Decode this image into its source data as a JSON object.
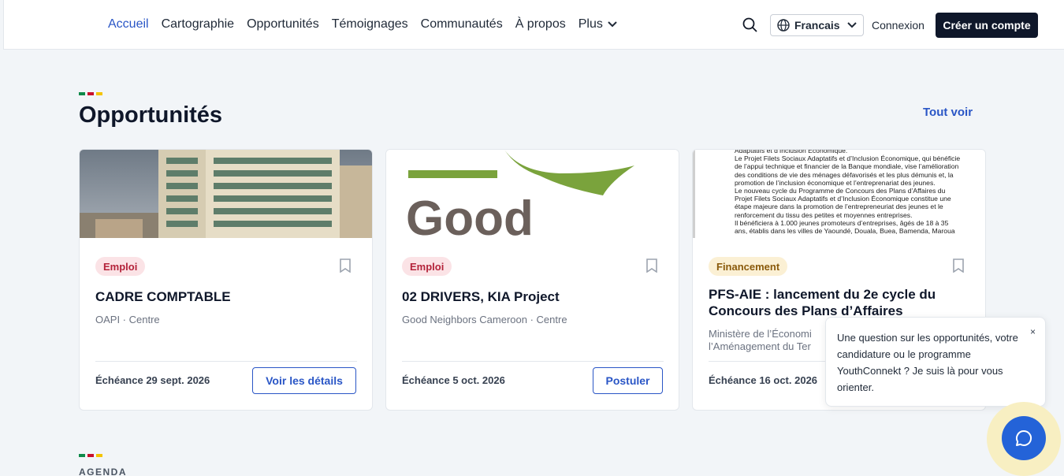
{
  "nav": {
    "items": [
      "Accueil",
      "Cartographie",
      "Opportunités",
      "Témoignages",
      "Communautés",
      "À propos"
    ],
    "more_label": "Plus",
    "active": "Accueil"
  },
  "header": {
    "language": "Francais",
    "login_label": "Connexion",
    "signup_label": "Créer un compte"
  },
  "colors": {
    "accent": "#2a56c6",
    "dark": "#0f172a",
    "flag": [
      "#0f8a4a",
      "#c8102e",
      "#f4c400"
    ]
  },
  "section": {
    "title": "Opportunités",
    "see_all_label": "Tout voir"
  },
  "cards": [
    {
      "badge": "Emploi",
      "title": "CADRE COMPTABLE",
      "subtitle": "OAPI · Centre",
      "deadline": "Échéance 29 sept. 2026",
      "cta": "Voir les détails"
    },
    {
      "badge": "Emploi",
      "image_text": "Good",
      "title": "02 DRIVERS, KIA Project",
      "subtitle": "Good Neighbors Cameroon · Centre",
      "deadline": "Échéance 5 oct. 2026",
      "cta": "Postuler"
    },
    {
      "badge": "Financement",
      "title": "PFS-AIE : lancement du 2e cycle du Concours des Plans d’Affaires",
      "subtitle_line1": "Ministère de l’Économi",
      "subtitle_line2": "l’Aménagement du Ter",
      "deadline": "Échéance 16 oct. 2026",
      "doc_lines": [
        "Adaptatifs et d’Inclusion Économique.",
        "Le Projet Filets Sociaux Adaptatifs et d’Inclusion Économique, qui bénéficie",
        "de l’appui technique et financier de la Banque mondiale, vise l’amélioration",
        "des conditions de vie des ménages défavorisés et les plus démunis et, la",
        "promotion de l’inclusion économique et l’entreprenariat des jeunes.",
        "Le nouveau cycle du Programme de Concours des Plans d’Affaires du",
        "Projet Filets Sociaux Adaptatifs et d’Inclusion Économique constitue une",
        "étape majeure dans la promotion de l’entrepreneuriat des jeunes et le",
        "renforcement du tissu des petites et moyennes entreprises.",
        "Il bénéficiera à 1.000 jeunes promoteurs d’entreprises, âgés de 18 à 35",
        "ans, établis dans les villes de Yaoundé, Douala, Buea, Bamenda, Maroua"
      ]
    }
  ],
  "chat": {
    "message": "Une question sur les opportunités, votre candidature ou le programme YouthConnekt ? Je suis là pour vous orienter.",
    "close": "×"
  },
  "agenda_label": "AGENDA"
}
